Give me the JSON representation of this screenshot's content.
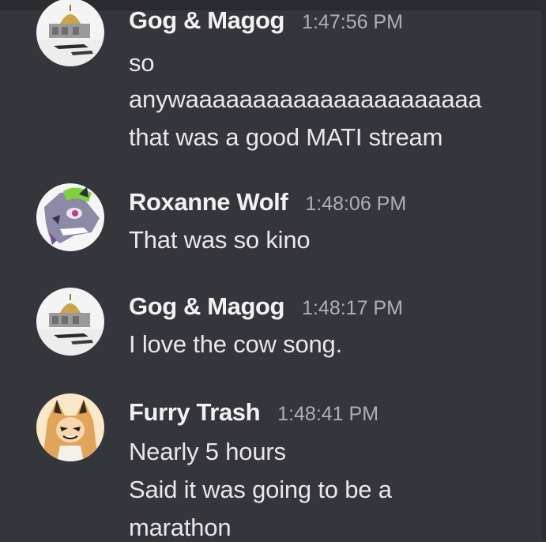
{
  "messages": [
    {
      "username": "Gog & Magog",
      "timestamp": "1:47:56 PM",
      "avatar_icon": "dome-of-the-rock-avatar",
      "lines": [
        "so",
        "anywaaaaaaaaaaaaaaaaaaaaaa",
        "that was a good MATI stream"
      ]
    },
    {
      "username": "Roxanne Wolf",
      "timestamp": "1:48:06 PM",
      "avatar_icon": "wolf-avatar",
      "lines": [
        "That was so kino"
      ]
    },
    {
      "username": "Gog & Magog",
      "timestamp": "1:48:17 PM",
      "avatar_icon": "dome-of-the-rock-avatar",
      "lines": [
        "I love the cow song."
      ]
    },
    {
      "username": "Furry Trash",
      "timestamp": "1:48:41 PM",
      "avatar_icon": "fox-girl-avatar",
      "lines": [
        "Nearly 5 hours",
        "Said it was going to be a",
        "marathon"
      ]
    }
  ],
  "colors": {
    "background": "#35363c",
    "username": "#f2f2f4",
    "timestamp": "#aeb0b6",
    "text": "#e8e8ea"
  }
}
